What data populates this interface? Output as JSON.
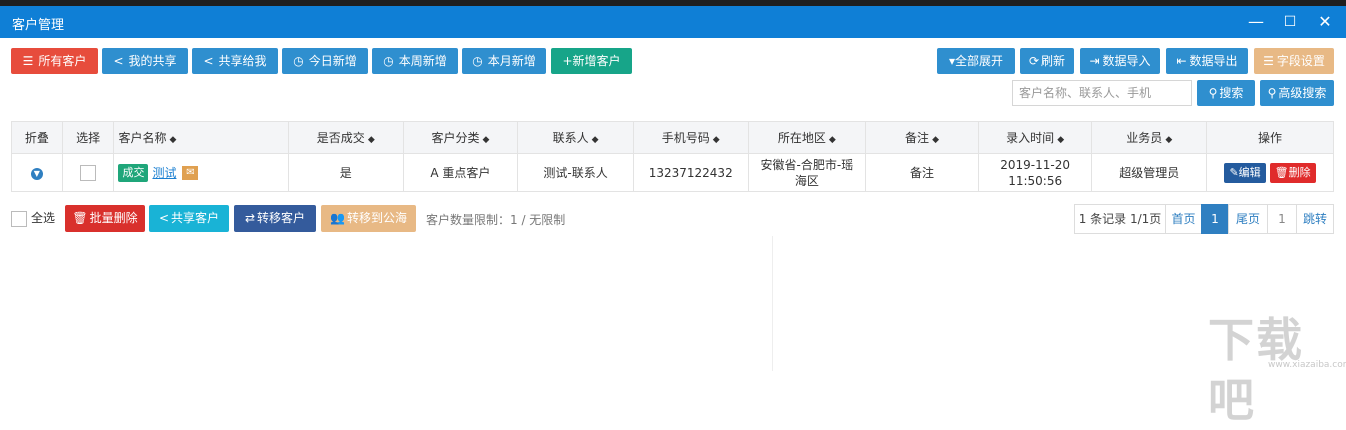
{
  "window": {
    "title": "客户管理",
    "minimize": "—",
    "maximize": "☐",
    "close": "✕"
  },
  "toolbar": {
    "all": "所有客户",
    "myshare": "我的共享",
    "sharedtome": "共享给我",
    "today": "今日新增",
    "week": "本周新增",
    "month": "本月新增",
    "add": "+新增客户",
    "expand": "▾全部展开",
    "refresh": "刷新",
    "import": "数据导入",
    "export": "数据导出",
    "fields": "字段设置"
  },
  "search": {
    "placeholder": "客户名称、联系人、手机",
    "button": "搜索",
    "advanced": "高级搜索"
  },
  "table": {
    "headers": [
      "折叠",
      "选择",
      "客户名称",
      "是否成交",
      "客户分类",
      "联系人",
      "手机号码",
      "所在地区",
      "备注",
      "录入时间",
      "业务员",
      "操作"
    ],
    "rows": [
      {
        "badge": "成交",
        "name": "测试",
        "deal": "是",
        "category": "A 重点客户",
        "contact": "测试-联系人",
        "phone": "13237122432",
        "region_line1": "安徽省-合肥市-瑶",
        "region_line2": "海区",
        "remark": "备注",
        "date": "2019-11-20",
        "time": "11:50:56",
        "staff": "超级管理员",
        "edit": "编辑",
        "delete": "删除"
      }
    ]
  },
  "bottom": {
    "selectall": "全选",
    "batchdelete": "批量删除",
    "share": "共享客户",
    "transfer": "转移客户",
    "topublic": "转移到公海",
    "limit": "客户数量限制：1 / 无限制"
  },
  "pagination": {
    "info": "1 条记录 1/1页",
    "first": "首页",
    "current": "1",
    "last": "尾页",
    "jump_value": "1",
    "jump": "跳转"
  },
  "watermark": {
    "text": "下载吧",
    "sub": "www.xiazaiba.com"
  },
  "colors": {
    "titlebar": "#0f7fd6",
    "danger": "#e74c3c",
    "primary": "#2f8fcf",
    "teal": "#17a589",
    "warning": "#e8b985"
  }
}
